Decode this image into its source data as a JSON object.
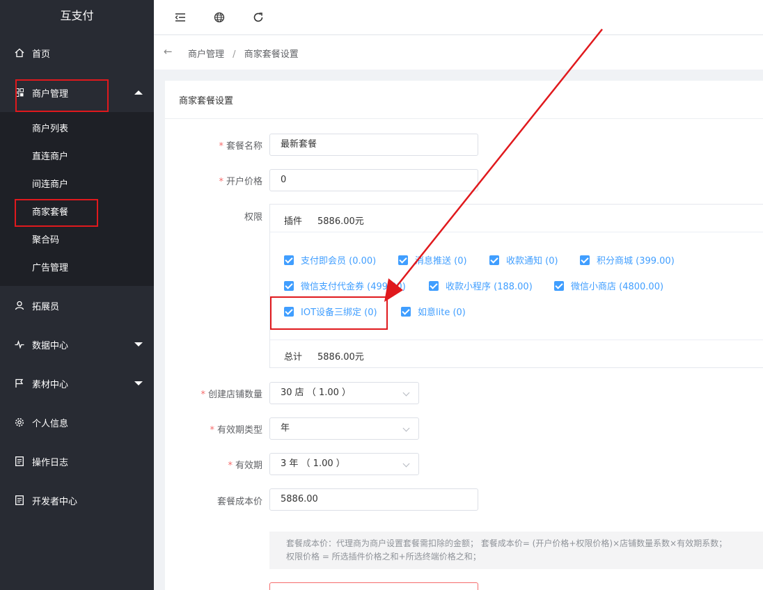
{
  "app": {
    "title": "互支付"
  },
  "sidebar": {
    "items": [
      {
        "label": "首页",
        "icon": "home-icon"
      },
      {
        "label": "商户管理",
        "icon": "grid-icon",
        "expanded": true
      },
      {
        "label": "拓展员",
        "icon": "user-icon"
      },
      {
        "label": "数据中心",
        "icon": "pulse-icon"
      },
      {
        "label": "素材中心",
        "icon": "flag-icon"
      },
      {
        "label": "个人信息",
        "icon": "gear-icon"
      },
      {
        "label": "操作日志",
        "icon": "doc-icon"
      },
      {
        "label": "开发者中心",
        "icon": "doc-icon"
      }
    ],
    "submenu": [
      {
        "label": "商户列表"
      },
      {
        "label": "直连商户"
      },
      {
        "label": "间连商户"
      },
      {
        "label": "商家套餐",
        "active": true
      },
      {
        "label": "聚合码"
      },
      {
        "label": "广告管理"
      }
    ]
  },
  "breadcrumb": {
    "parent": "商户管理",
    "separator": "/",
    "current": "商家套餐设置"
  },
  "card": {
    "title": "商家套餐设置"
  },
  "form": {
    "package_name": {
      "label": "套餐名称",
      "value": "最新套餐"
    },
    "open_price": {
      "label": "开户价格",
      "value": "0"
    },
    "permissions": {
      "label": "权限",
      "plugin_label": "插件",
      "plugin_total": "5886.00元",
      "total_label": "总计",
      "total": "5886.00元",
      "options": [
        {
          "label": "支付即会员 (0.00)",
          "checked": true
        },
        {
          "label": "消息推送 (0)",
          "checked": true
        },
        {
          "label": "收款通知 (0)",
          "checked": true
        },
        {
          "label": "积分商城 (399.00)",
          "checked": true
        },
        {
          "label": "微信支付代金券 (499.00)",
          "checked": true
        },
        {
          "label": "收款小程序 (188.00)",
          "checked": true
        },
        {
          "label": "微信小商店 (4800.00)",
          "checked": true
        },
        {
          "label": "IOT设备三绑定 (0)",
          "checked": true
        },
        {
          "label": "如意lite (0)",
          "checked": true
        }
      ]
    },
    "store_count": {
      "label": "创建店铺数量",
      "value": "30 店 （ 1.00 ）"
    },
    "validity_type": {
      "label": "有效期类型",
      "value": "年"
    },
    "validity": {
      "label": "有效期",
      "value": "3 年 （ 1.00 ）"
    },
    "cost_price": {
      "label": "套餐成本价",
      "value": "5886.00"
    },
    "tip_line1": "套餐成本价：代理商为商户设置套餐需扣除的金额； 套餐成本价= (开户价格+权限价格)×店铺数量系数×有效期系数；",
    "tip_line2": "权限价格 = 所选插件价格之和+所选终端价格之和；"
  },
  "colors": {
    "sidebar_bg": "#282b33",
    "accent": "#409eff",
    "annotation": "#e0191d"
  }
}
